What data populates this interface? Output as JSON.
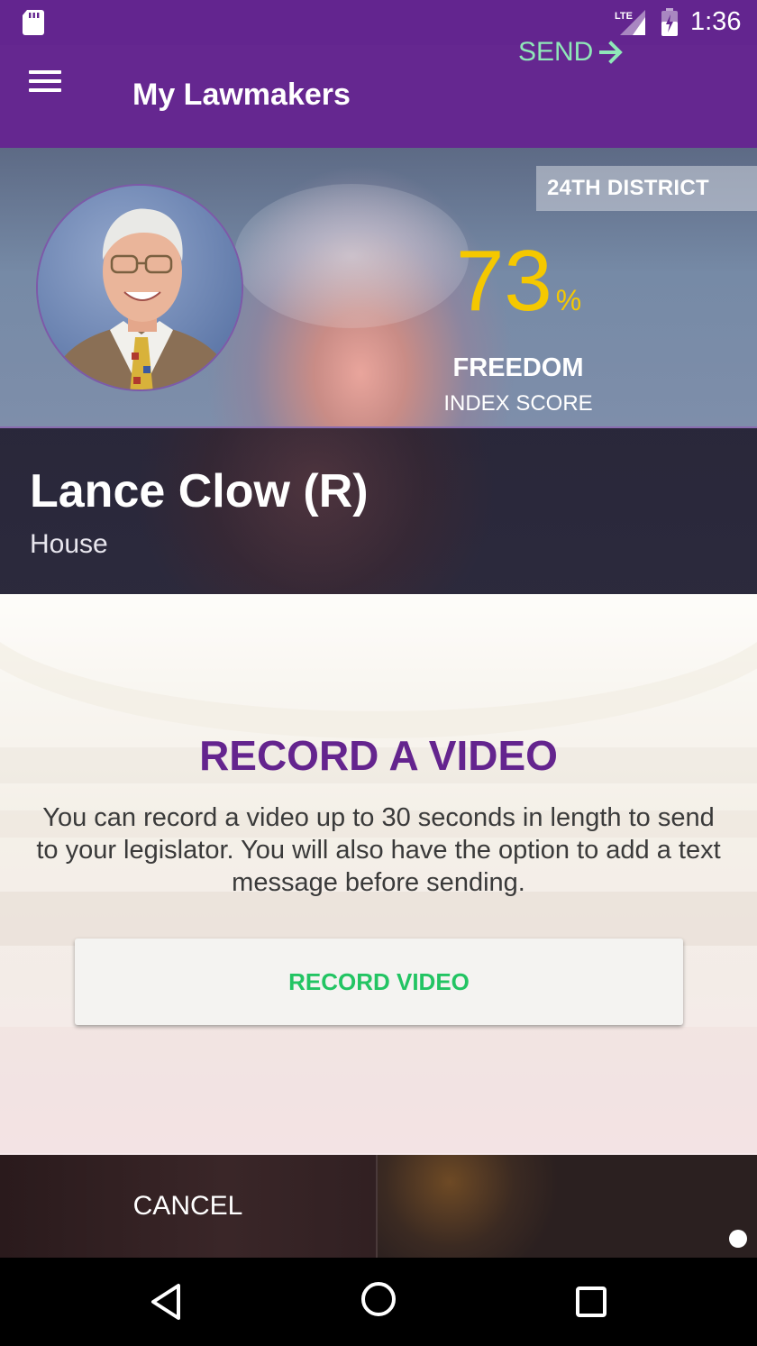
{
  "status_bar": {
    "time": "1:36",
    "network": "LTE",
    "icons": [
      "sd-card-icon",
      "lte-signal-icon",
      "battery-icon"
    ]
  },
  "app_bar": {
    "title": "My Lawmakers",
    "menu_icon": "menu-icon"
  },
  "lawmaker": {
    "district": "24TH DISTRICT",
    "score_value": "73",
    "score_unit": "%",
    "score_label": "FREEDOM",
    "score_sublabel": "INDEX SCORE",
    "name": "Lance Clow (R)",
    "chamber": "House"
  },
  "record": {
    "title": "RECORD A VIDEO",
    "description": "You can record a video up to 30 seconds in length to send to your legislator. You will also have the option to add a text message before sending.",
    "button_label": "RECORD VIDEO"
  },
  "actions": {
    "cancel_label": "CANCEL",
    "send_label": "SEND"
  },
  "colors": {
    "primary": "#652790",
    "accent_score": "#f5c800",
    "button_text": "#22c463",
    "send_text": "#8fe7b8"
  },
  "nav": {
    "icons": [
      "back-icon",
      "home-icon",
      "recents-icon"
    ]
  }
}
